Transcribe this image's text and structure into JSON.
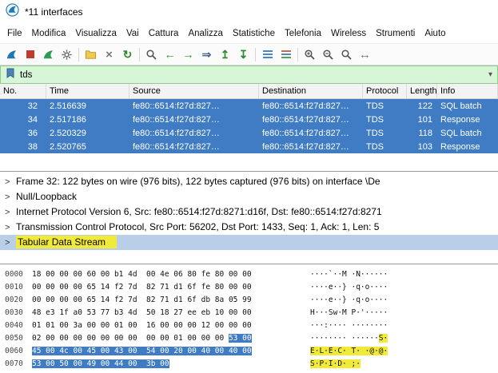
{
  "window": {
    "title": "*11 interfaces"
  },
  "menu": {
    "items": [
      "File",
      "Modifica",
      "Visualizza",
      "Vai",
      "Cattura",
      "Analizza",
      "Statistiche",
      "Telefonia",
      "Wireless",
      "Strumenti",
      "Aiuto"
    ]
  },
  "toolbar": {
    "icons": [
      "capture-start",
      "capture-stop",
      "capture-restart",
      "capture-options",
      "file-open",
      "file-close",
      "reload",
      "find-packet",
      "go-back",
      "go-forward",
      "go-to-packet",
      "go-top",
      "go-bottom",
      "auto-scroll",
      "colorize",
      "zoom-in",
      "zoom-out",
      "zoom-reset",
      "resize-columns"
    ]
  },
  "filter": {
    "value": "tds"
  },
  "packet_list": {
    "columns": [
      "No.",
      "Time",
      "Source",
      "Destination",
      "Protocol",
      "Length",
      "Info"
    ],
    "rows": [
      {
        "no": "32",
        "time": "2.516639",
        "source": "fe80::6514:f27d:827…",
        "destination": "fe80::6514:f27d:827…",
        "protocol": "TDS",
        "length": "122",
        "info": "SQL batch"
      },
      {
        "no": "34",
        "time": "2.517186",
        "source": "fe80::6514:f27d:827…",
        "destination": "fe80::6514:f27d:827…",
        "protocol": "TDS",
        "length": "101",
        "info": "Response"
      },
      {
        "no": "36",
        "time": "2.520329",
        "source": "fe80::6514:f27d:827…",
        "destination": "fe80::6514:f27d:827…",
        "protocol": "TDS",
        "length": "118",
        "info": "SQL batch"
      },
      {
        "no": "38",
        "time": "2.520765",
        "source": "fe80::6514:f27d:827…",
        "destination": "fe80::6514:f27d:827…",
        "protocol": "TDS",
        "length": "103",
        "info": "Response"
      }
    ]
  },
  "details": {
    "expander_glyph": ">",
    "rows": [
      {
        "text": "Frame 32: 122 bytes on wire (976 bits), 122 bytes captured (976 bits) on interface \\De"
      },
      {
        "text": "Null/Loopback"
      },
      {
        "text": "Internet Protocol Version 6, Src: fe80::6514:f27d:8271:d16f, Dst: fe80::6514:f27d:8271"
      },
      {
        "text": "Transmission Control Protocol, Src Port: 56202, Dst Port: 1433, Seq: 1, Ack: 1, Len: 5"
      },
      {
        "text": "Tabular Data Stream"
      }
    ]
  },
  "hex_dump": {
    "rows": [
      {
        "offset": "0000",
        "hex": "18 00 00 00 60 00 b1 4d  00 4e 06 80 fe 80 00 00",
        "hex_sel": "",
        "ascii": "····`··M ·N······",
        "ascii_sel": ""
      },
      {
        "offset": "0010",
        "hex": "00 00 00 00 65 14 f2 7d  82 71 d1 6f fe 80 00 00",
        "hex_sel": "",
        "ascii": "····e··} ·q·o····",
        "ascii_sel": ""
      },
      {
        "offset": "0020",
        "hex": "00 00 00 00 65 14 f2 7d  82 71 d1 6f db 8a 05 99",
        "hex_sel": "",
        "ascii": "····e··} ·q·o····",
        "ascii_sel": ""
      },
      {
        "offset": "0030",
        "hex": "48 e3 1f a0 53 77 b3 4d  50 18 27 ee eb 10 00 00",
        "hex_sel": "",
        "ascii": "H···Sw·M P·'·····",
        "ascii_sel": ""
      },
      {
        "offset": "0040",
        "hex": "01 01 00 3a 00 00 01 00  16 00 00 00 12 00 00 00",
        "hex_sel": "",
        "ascii": "···:···· ········",
        "ascii_sel": ""
      },
      {
        "offset": "0050",
        "hex": "02 00 00 00 00 00 00 00  00 00 01 00 00 00 ",
        "hex_sel": "53 00",
        "ascii": "········ ······",
        "ascii_sel": "S·"
      },
      {
        "offset": "0060",
        "hex": "",
        "hex_sel": "45 00 4c 00 45 00 43 00  54 00 20 00 40 00 40 00",
        "ascii": "",
        "ascii_sel": "E·L·E·C· T· ·@·@·"
      },
      {
        "offset": "0070",
        "hex": "",
        "hex_sel": "53 00 50 00 49 00 44 00  3b 00",
        "ascii": "",
        "ascii_sel": "S·P·I·D· ;·"
      }
    ]
  },
  "colors": {
    "selection_blue": "#3f7cc4",
    "highlight_yellow": "#f2ea38",
    "filter_green": "#d7f5d7",
    "details_selected_blue": "#b9cfe8"
  }
}
